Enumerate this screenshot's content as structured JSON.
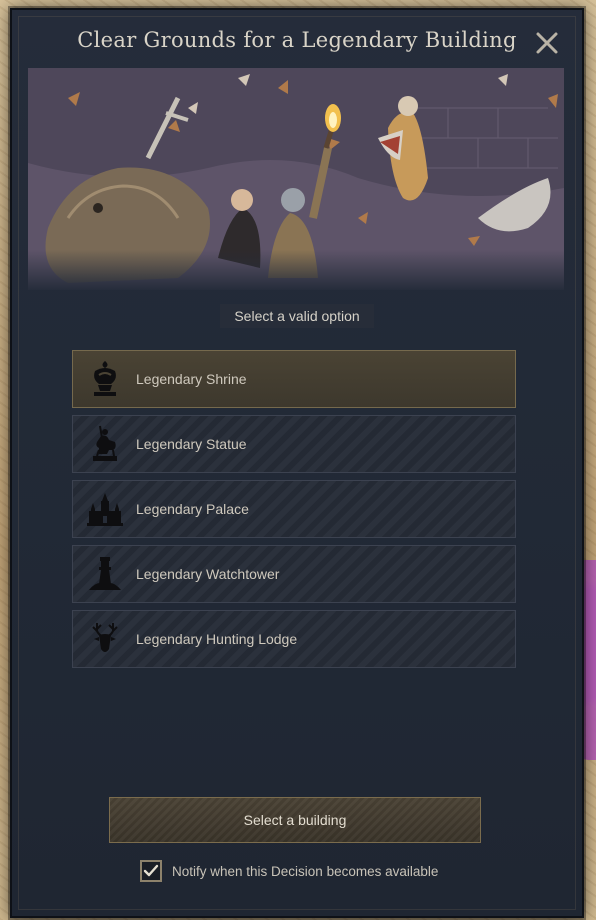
{
  "window": {
    "title": "Clear Grounds for a Legendary Building",
    "close_icon": "close-icon"
  },
  "prompt": "Select a valid option",
  "options": [
    {
      "label": "Legendary Shrine",
      "icon": "shrine-icon",
      "selected": true
    },
    {
      "label": "Legendary Statue",
      "icon": "statue-icon",
      "selected": false
    },
    {
      "label": "Legendary Palace",
      "icon": "palace-icon",
      "selected": false
    },
    {
      "label": "Legendary Watchtower",
      "icon": "watchtower-icon",
      "selected": false
    },
    {
      "label": "Legendary Hunting Lodge",
      "icon": "hunting-lodge-icon",
      "selected": false
    }
  ],
  "action_button": {
    "label": "Select a building"
  },
  "notify": {
    "label": "Notify when this Decision becomes available",
    "checked": true
  },
  "colors": {
    "window_bg": "#222a37",
    "selected_option": "#4a4334",
    "text": "#cfc9bd",
    "accent_border": "#7b6c4d"
  }
}
